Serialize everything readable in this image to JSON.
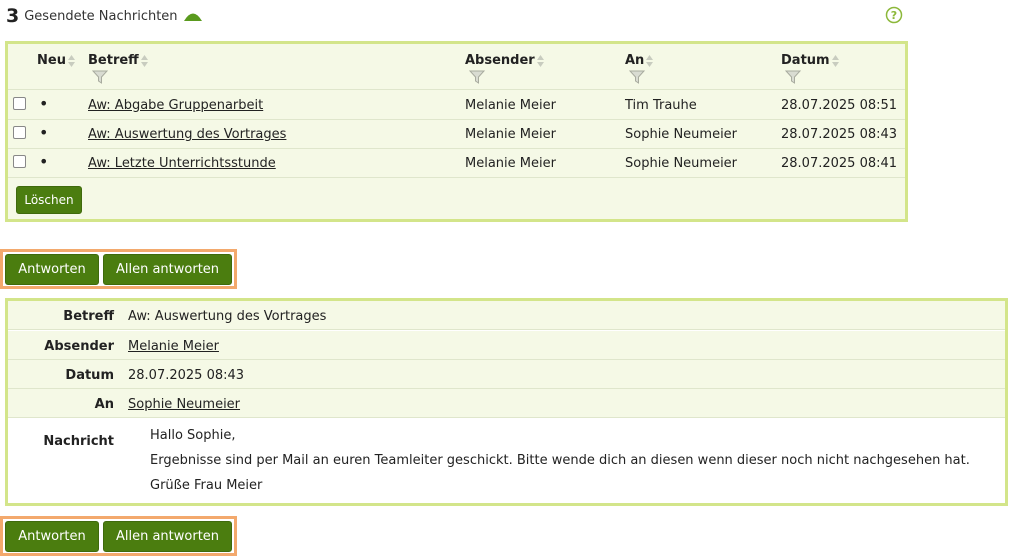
{
  "header": {
    "count": "3",
    "title": "Gesendete Nachrichten",
    "up_icon": "triangle-up-icon",
    "help_icon": "question-circle-icon"
  },
  "list": {
    "columns": {
      "neu": "Neu",
      "betreff": "Betreff",
      "absender": "Absender",
      "an": "An",
      "datum": "Datum"
    },
    "rows": [
      {
        "subject": "Aw: Abgabe Gruppenarbeit",
        "sender": "Melanie Meier",
        "to": "Tim Trauhe",
        "date": "28.07.2025 08:51"
      },
      {
        "subject": "Aw: Auswertung des Vortrages",
        "sender": "Melanie Meier",
        "to": "Sophie Neumeier",
        "date": "28.07.2025 08:43"
      },
      {
        "subject": "Aw: Letzte Unterrichtsstunde",
        "sender": "Melanie Meier",
        "to": "Sophie Neumeier",
        "date": "28.07.2025 08:41"
      }
    ],
    "new_marker": "•",
    "delete_label": "Löschen"
  },
  "reply": {
    "reply_label": "Antworten",
    "reply_all_label": "Allen antworten"
  },
  "detail": {
    "subject_label": "Betreff",
    "subject": "Aw: Auswertung des Vortrages",
    "sender_label": "Absender",
    "sender": "Melanie Meier",
    "date_label": "Datum",
    "date": "28.07.2025 08:43",
    "to_label": "An",
    "to": "Sophie Neumeier",
    "message_label": "Nachricht",
    "message_lines": [
      "Hallo Sophie,",
      "Ergebnisse sind per Mail an euren Teamleiter geschickt. Bitte wende dich an diesen wenn dieser noch nicht nachgesehen hat.",
      "Grüße Frau Meier"
    ]
  },
  "colors": {
    "accent_green": "#4b7d0f",
    "border_green": "#d3e58a",
    "border_orange": "#f3a96d",
    "row_bg": "#f5f9e6"
  }
}
